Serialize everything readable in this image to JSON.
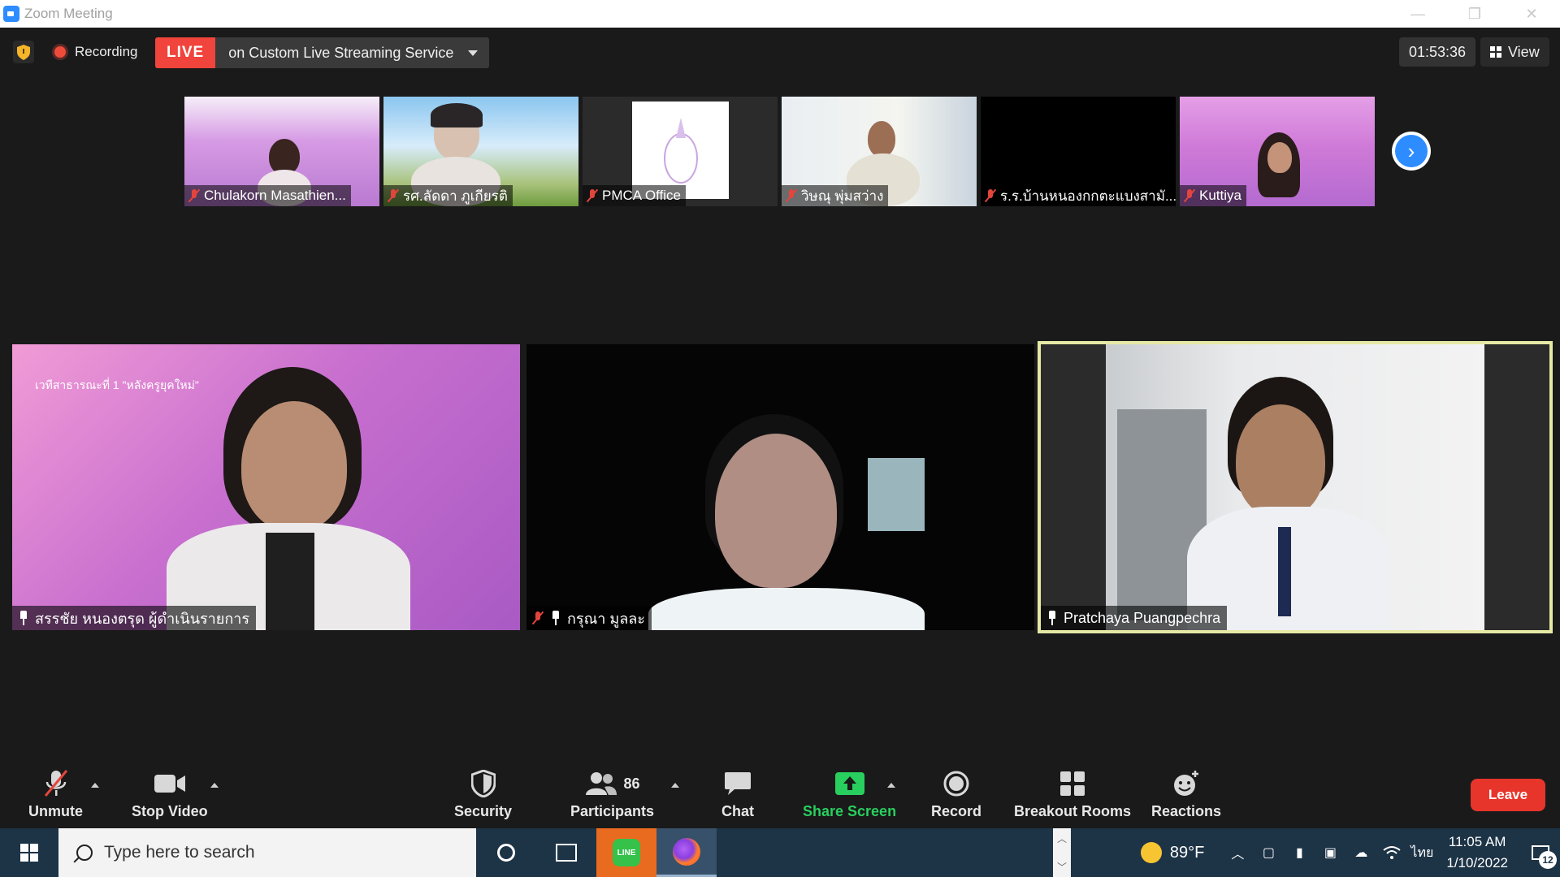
{
  "window": {
    "title": "Zoom Meeting"
  },
  "topbar": {
    "recording_label": "Recording",
    "live_badge": "LIVE",
    "live_service": "on Custom Live Streaming Service",
    "timer": "01:53:36",
    "view_label": "View"
  },
  "thumbnails": [
    {
      "name": "Chulakorn Masathien...",
      "muted": true
    },
    {
      "name": "รศ.ลัดดา ภูเกียรติ",
      "muted": true
    },
    {
      "name": "PMCA Office",
      "muted": true
    },
    {
      "name": "วิษณุ พุ่มสว่าง",
      "muted": true
    },
    {
      "name": "ร.ร.บ้านหนองกกตะแบงสามั...",
      "muted": true
    },
    {
      "name": "Kuttiya",
      "muted": true
    }
  ],
  "tiles": [
    {
      "name": "สรรชัย หนองตรุด ผู้ดำเนินรายการ",
      "pinned": true,
      "muted": false,
      "overlay_text": "เวทีสาธารณะที่ 1 \"หลังครูยุคใหม่\""
    },
    {
      "name": "กรุณา มูลละ",
      "pinned": true,
      "muted": true
    },
    {
      "name": "Pratchaya Puangpechra",
      "pinned": true,
      "muted": false,
      "active_speaker": true
    }
  ],
  "toolbar": {
    "unmute": "Unmute",
    "stop_video": "Stop Video",
    "security": "Security",
    "participants": "Participants",
    "participants_count": "86",
    "chat": "Chat",
    "share_screen": "Share Screen",
    "record": "Record",
    "breakout_rooms": "Breakout Rooms",
    "reactions": "Reactions",
    "leave": "Leave"
  },
  "taskbar": {
    "search_placeholder": "Type here to search",
    "line_label": "LINE",
    "temperature": "89°F",
    "language": "ไทย",
    "time": "11:05 AM",
    "date": "1/10/2022",
    "notification_count": "12"
  },
  "colors": {
    "live_red": "#f0443c",
    "leave_red": "#e8352b",
    "share_green": "#29cf5e",
    "active_border": "#e6e9a4",
    "accent_blue": "#2d8cff"
  }
}
